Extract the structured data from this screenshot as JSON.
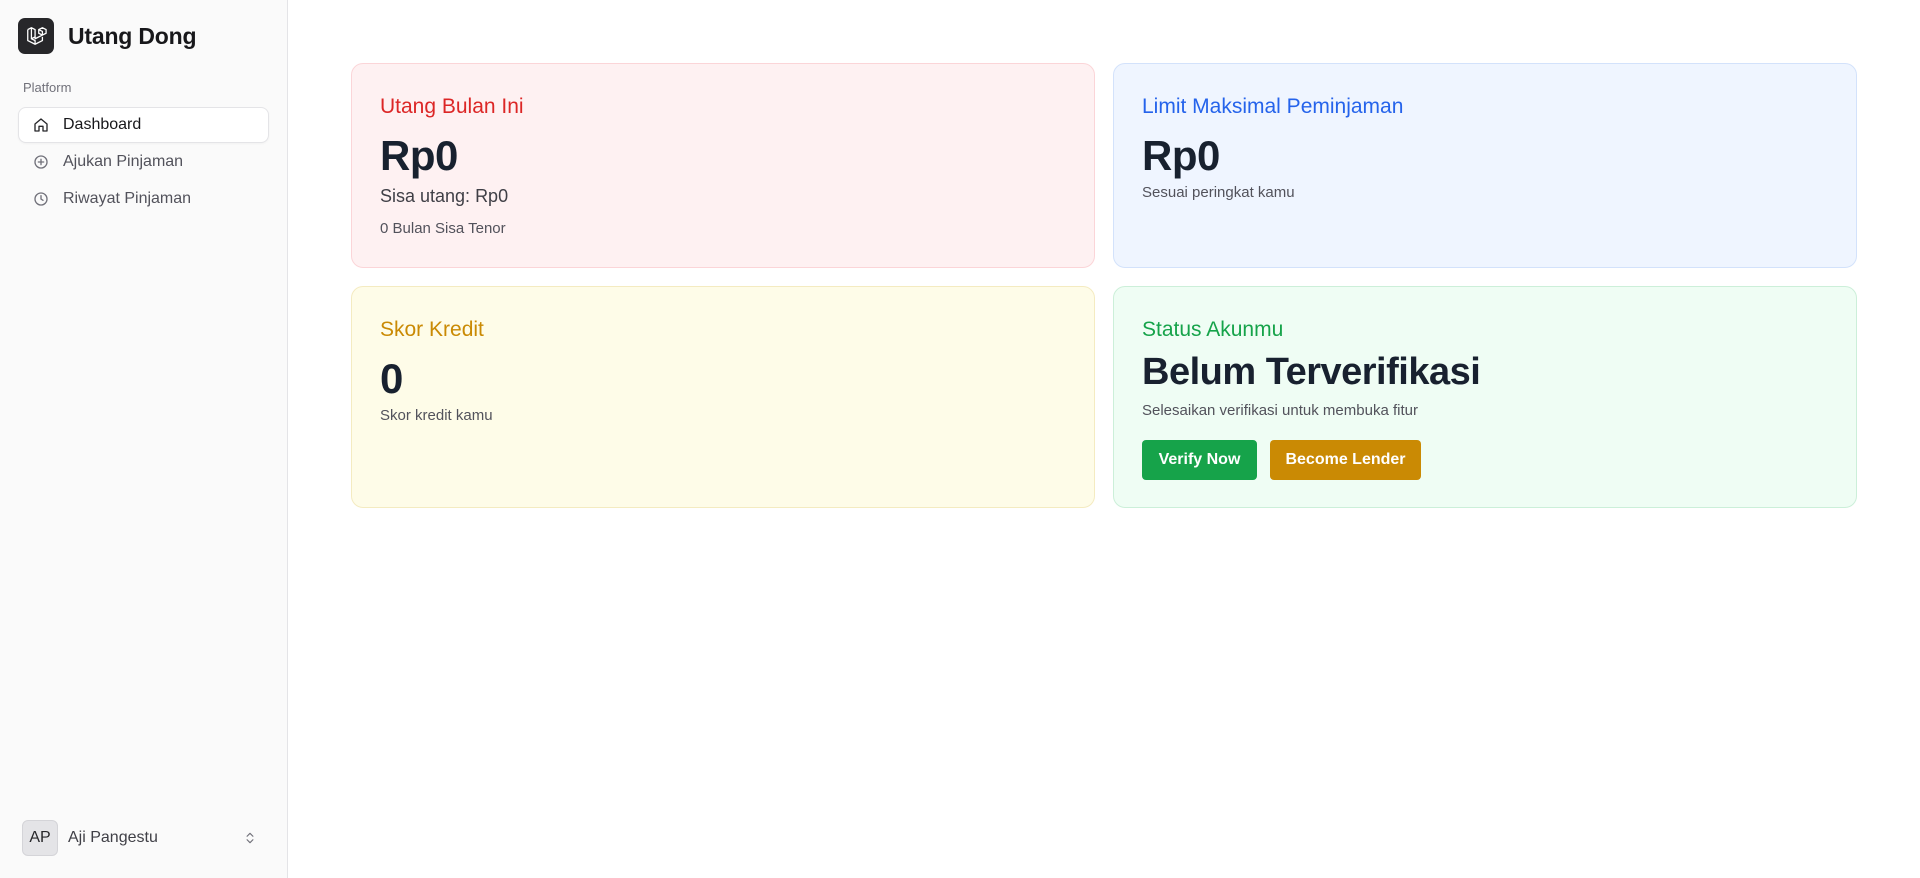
{
  "app": {
    "name": "Utang Dong",
    "logo_icon": "laravel-logo-icon"
  },
  "sidebar": {
    "group_label": "Platform",
    "items": [
      {
        "label": "Dashboard",
        "icon": "home-icon",
        "active": true
      },
      {
        "label": "Ajukan Pinjaman",
        "icon": "plus-circle-icon",
        "active": false
      },
      {
        "label": "Riwayat Pinjaman",
        "icon": "clock-icon",
        "active": false
      }
    ],
    "user": {
      "initials": "AP",
      "name": "Aji Pangestu",
      "menu_icon": "chevrons-up-down-icon"
    }
  },
  "cards": {
    "debt": {
      "title": "Utang Bulan Ini",
      "value": "Rp0",
      "remaining": "Sisa utang: Rp0",
      "tenor": "0 Bulan Sisa Tenor",
      "color": "#dc2626"
    },
    "limit": {
      "title": "Limit Maksimal Peminjaman",
      "value": "Rp0",
      "note": "Sesuai peringkat kamu",
      "color": "#2563eb"
    },
    "credit": {
      "title": "Skor Kredit",
      "value": "0",
      "note": "Skor kredit kamu",
      "color": "#ca8a04"
    },
    "status": {
      "title": "Status Akunmu",
      "value": "Belum Terverifikasi",
      "note": "Selesaikan verifikasi untuk membuka fitur",
      "color": "#16a34a",
      "verify_label": "Verify Now",
      "lender_label": "Become Lender"
    }
  }
}
